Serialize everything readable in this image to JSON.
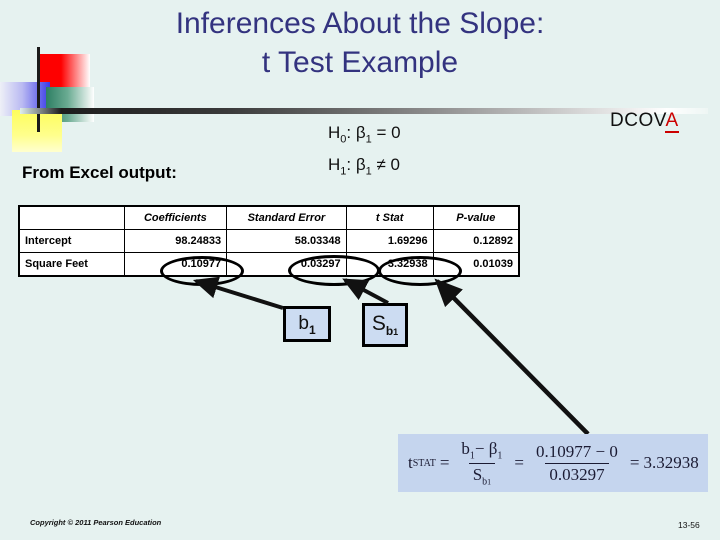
{
  "slide": {
    "title_line1": "Inferences About the Slope:",
    "title_line2": "t Test Example",
    "badge": "DCOV",
    "badge_accent": "A",
    "excel_label": "From Excel output:",
    "title_color": "#33337f",
    "badge_accent_color": "#cc0000",
    "background_color": "#e6f2f0"
  },
  "hypotheses": {
    "null_symbol": "H",
    "null_sub": "0",
    "null_statement": ": β",
    "null_param_sub": "1",
    "null_rest": " = 0",
    "alt_symbol": "H",
    "alt_sub": "1",
    "alt_statement": ": β",
    "alt_param_sub": "1",
    "alt_rest": " ≠ 0",
    "line1": "H0: β1 = 0",
    "line2": "H1: β1 ≠ 0"
  },
  "table": {
    "headers": [
      "",
      "Coefficients",
      "Standard Error",
      "t Stat",
      "P-value"
    ],
    "rows": [
      {
        "label": "Intercept",
        "coefficients": "98.24833",
        "standard_error": "58.03348",
        "t_stat": "1.69296",
        "p_value": "0.12892"
      },
      {
        "label": "Square Feet",
        "coefficients": "0.10977",
        "standard_error": "0.03297",
        "t_stat": "3.32938",
        "p_value": "0.01039"
      }
    ]
  },
  "callouts": {
    "b1_main": "b",
    "b1_sub": "1",
    "sb1_main": "S",
    "sb1_sub": "b",
    "sb1_subsub": "1"
  },
  "formula": {
    "lhs_var": "t",
    "lhs_sub": "STAT",
    "eq1": "=",
    "numer1_b": "b",
    "numer1_b_sub": "1",
    "numer1_minus": "− β",
    "numer1_beta_sub": "1",
    "denom1_s": "S",
    "denom1_sub": "b",
    "denom1_subsub": "1",
    "eq2": "=",
    "numer2": "0.10977 − 0",
    "denom2": "0.03297",
    "eq3": "=",
    "result": "3.32938",
    "plain": "t_STAT = (b1 − β1) / S_b1 = (0.10977 − 0) / 0.03297 = 3.32938",
    "background_color": "#c5d5ee"
  },
  "footer": {
    "copyright": "Copyright © 2011 Pearson Education",
    "slide_number": "13-56"
  }
}
